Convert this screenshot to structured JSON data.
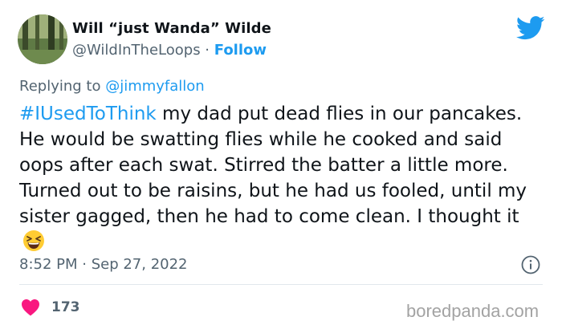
{
  "tweet": {
    "author_name": "Will “just Wanda” Wilde",
    "author_handle": "@WildInTheLoops",
    "separator": " · ",
    "follow_label": "Follow",
    "replying_prefix": "Replying to ",
    "replying_mention": "@jimmyfallon",
    "hashtag": "#IUsedToThink",
    "text": " my dad put dead flies in our pancakes. He would be swatting flies while he cooked and said oops after each swat. Stirred the batter a little more. Turned out to be raisins, but he had us fooled, until my sister gagged, then he had to come clean. I thought it",
    "emoji": "grinning-squinting-face",
    "timestamp": "8:52 PM · Sep 27, 2022",
    "like_count": "173"
  },
  "icons": {
    "logo": "twitter-bird-icon",
    "info": "info-icon",
    "like": "heart-icon"
  },
  "colors": {
    "accent": "#1d9bf0",
    "heart": "#f91880",
    "muted": "#536471"
  },
  "watermark": "boredpanda.com"
}
